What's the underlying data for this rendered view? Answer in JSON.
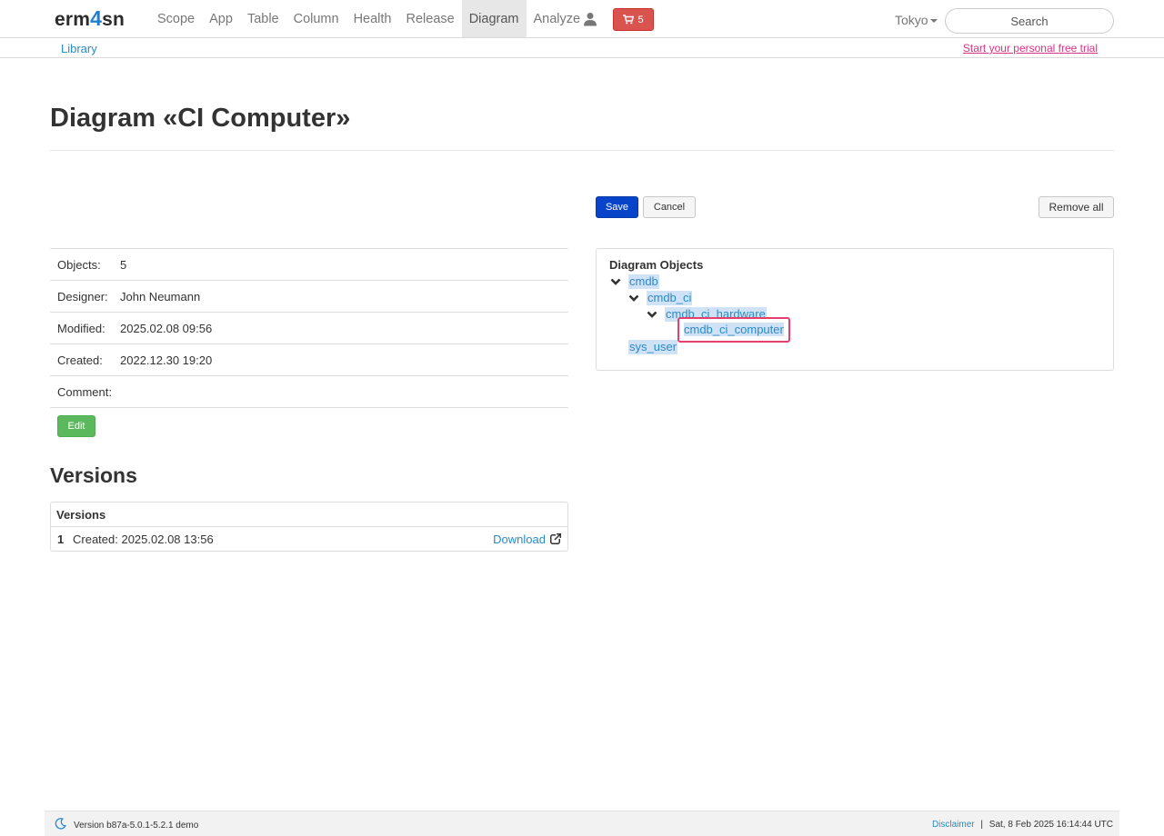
{
  "brand": {
    "part1": "erm",
    "part2": "4",
    "part3": "sn"
  },
  "nav": {
    "items": [
      "Scope",
      "App",
      "Table",
      "Column",
      "Health",
      "Release",
      "Diagram",
      "Analyze"
    ],
    "active": "Diagram",
    "cart_count": "5",
    "location": "Tokyo",
    "search_placeholder": "Search"
  },
  "subnav": {
    "library": "Library",
    "trial": "Start your personal free trial"
  },
  "page": {
    "title": "Diagram «CI Computer»"
  },
  "toolbar": {
    "save": "Save",
    "cancel": "Cancel",
    "remove_all": "Remove all"
  },
  "properties": [
    {
      "label": "Objects:",
      "value": "5"
    },
    {
      "label": "Designer:",
      "value": "John Neumann"
    },
    {
      "label": "Modified:",
      "value": "2025.02.08 09:56"
    },
    {
      "label": "Created:",
      "value": "2022.12.30 19:20"
    },
    {
      "label": "Comment:",
      "value": ""
    }
  ],
  "edit_button": "Edit",
  "versions": {
    "heading": "Versions",
    "panel_title": "Versions",
    "rows": [
      {
        "number": "1",
        "created": "Created: 2025.02.08 13:56",
        "action": "Download"
      }
    ]
  },
  "diagram_objects": {
    "title": "Diagram Objects",
    "tree": [
      {
        "label": "cmdb",
        "expanded": true
      },
      {
        "label": "cmdb_ci",
        "expanded": true
      },
      {
        "label": "cmdb_ci_hardware",
        "expanded": true
      },
      {
        "label": "cmdb_ci_computer",
        "selected": true
      },
      {
        "label": "sys_user"
      }
    ]
  },
  "footer": {
    "version": "Version b87a-5.0.1-5.2.1 demo",
    "disclaimer": "Disclaimer",
    "separator": "|",
    "timestamp": "Sat, 8 Feb 2025 16:14:44 UTC"
  },
  "colors": {
    "primary": "#0844c9",
    "link": "#2a8bc9",
    "danger": "#d9534f",
    "success": "#5cb85c",
    "trial_link": "#d63384",
    "selection_border": "#e43f6f",
    "tree_highlight": "#cfe2f6"
  }
}
